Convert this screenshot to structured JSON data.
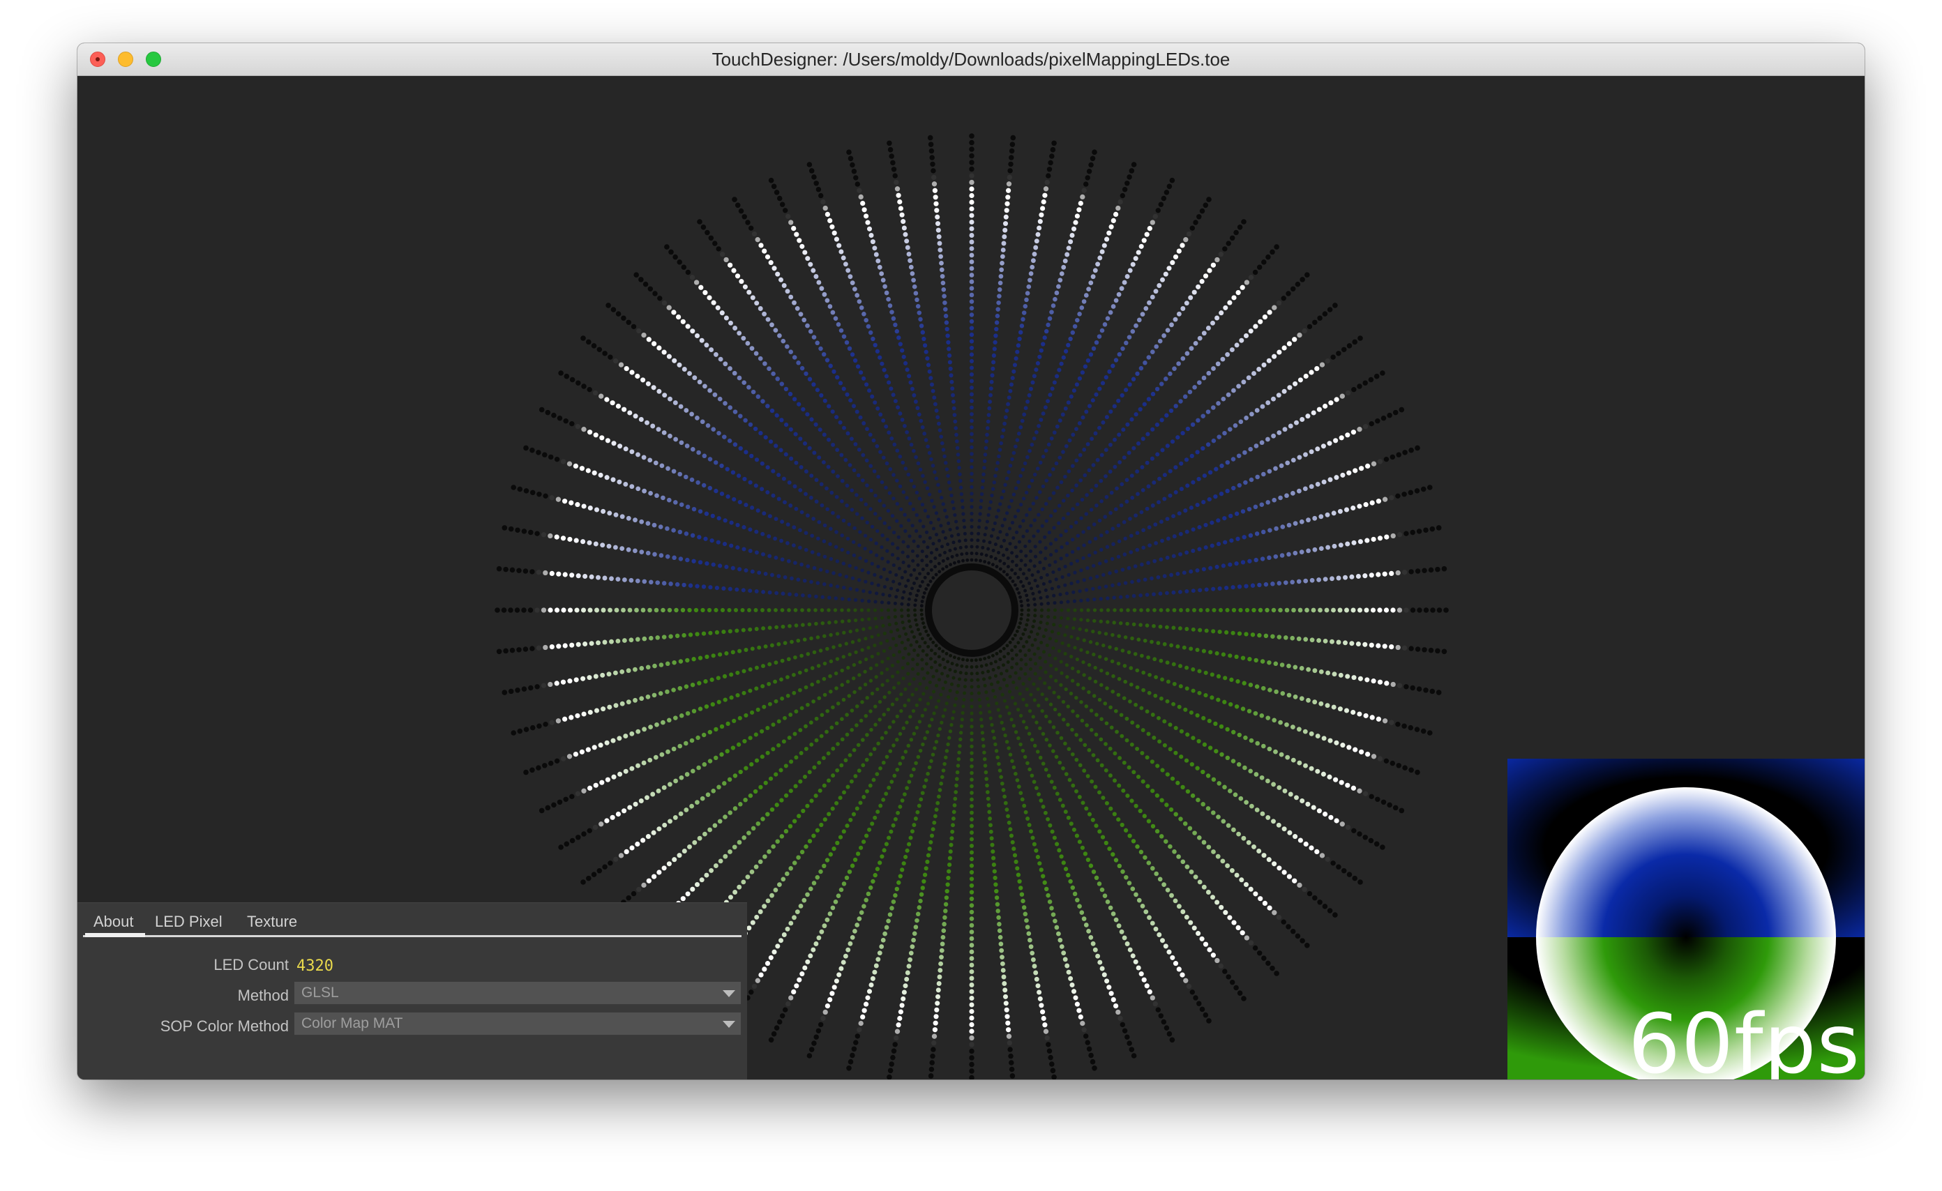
{
  "window": {
    "title": "TouchDesigner: /Users/moldy/Downloads/pixelMappingLEDs.toe"
  },
  "led_visualization": {
    "spoke_count": 72,
    "colors": {
      "top_half": "#1b2f8c",
      "bottom_half": "#3f8a12",
      "bright_ring": "#ffffff",
      "outer_dim": "#0a0a0a",
      "background": "#262626"
    }
  },
  "parameters": {
    "tabs": [
      {
        "label": "About"
      },
      {
        "label": "LED Pixel"
      },
      {
        "label": "Texture"
      }
    ],
    "active_tab": "About",
    "led_count": {
      "label": "LED Count",
      "value": "4320"
    },
    "method": {
      "label": "Method",
      "value": "GLSL"
    },
    "sop_color_method": {
      "label": "SOP Color Method",
      "value": "Color Map MAT"
    }
  },
  "preview": {
    "fps_text": "60fps",
    "colors": {
      "blue": "#0a2aa8",
      "green": "#2f9a0a",
      "black": "#000000",
      "white": "#ffffff"
    }
  }
}
